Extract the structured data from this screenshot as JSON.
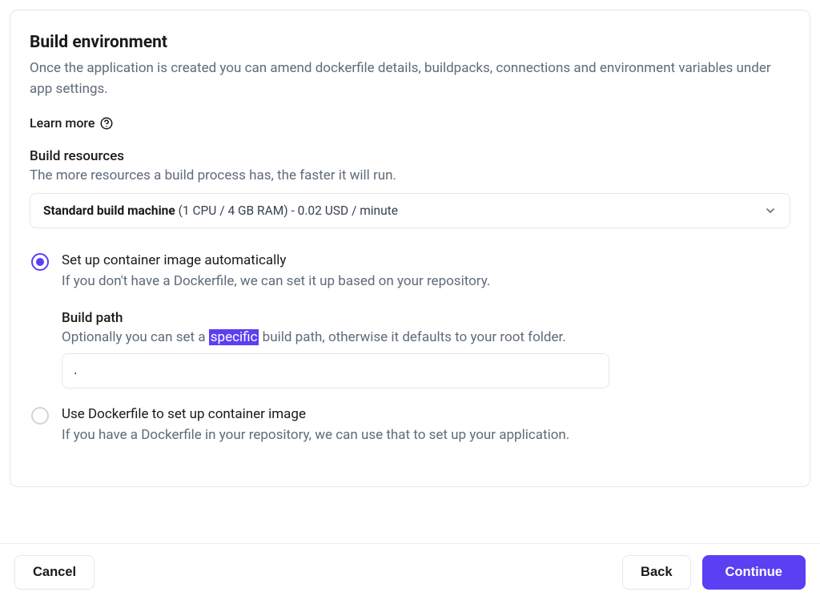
{
  "section": {
    "title": "Build environment",
    "description": "Once the application is created you can amend dockerfile details, buildpacks, connections and environment variables under app settings.",
    "learn_more_label": "Learn more"
  },
  "build_resources": {
    "heading": "Build resources",
    "description": "The more resources a build process has, the faster it will run.",
    "selected_name": "Standard build machine",
    "selected_details": " (1 CPU / 4 GB RAM) - 0.02 USD / minute"
  },
  "options": {
    "auto": {
      "title": "Set up container image automatically",
      "description": "If you don't have a Dockerfile, we can set it up based on your repository.",
      "selected": true,
      "build_path": {
        "label": "Build path",
        "desc_pre": "Optionally you can set a ",
        "desc_highlight": "specific",
        "desc_post": " build path, otherwise it defaults to your root folder.",
        "value": "."
      }
    },
    "dockerfile": {
      "title": "Use Dockerfile to set up container image",
      "description": "If you have a Dockerfile in your repository, we can use that to set up your application.",
      "selected": false
    }
  },
  "footer": {
    "cancel": "Cancel",
    "back": "Back",
    "continue": "Continue"
  }
}
